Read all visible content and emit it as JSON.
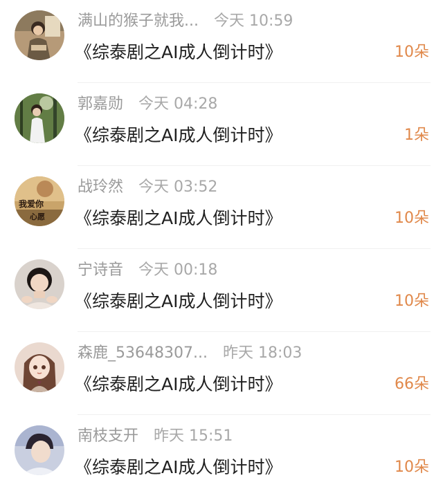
{
  "comments": [
    {
      "user": "满山的猴子就我...",
      "time": "今天 10:59",
      "title": "《综泰剧之AI成人倒计时》",
      "count": "10朵",
      "avatar": "avatar-photo-man-sitting"
    },
    {
      "user": "郭嘉勋",
      "time": "今天 04:28",
      "title": "《综泰剧之AI成人倒计时》",
      "count": "1朵",
      "avatar": "avatar-photo-girl-forest"
    },
    {
      "user": "战玲然",
      "time": "今天 03:52",
      "title": "《综泰剧之AI成人倒计时》",
      "count": "10朵",
      "avatar": "avatar-photo-text-art",
      "avatar_text": [
        "我爱你",
        "心愿"
      ]
    },
    {
      "user": "宁诗音",
      "time": "今天 00:18",
      "title": "《综泰剧之AI成人倒计时》",
      "count": "10朵",
      "avatar": "avatar-photo-woman-portrait"
    },
    {
      "user": "森鹿_53648307...",
      "time": "昨天 18:03",
      "title": "《综泰剧之AI成人倒计时》",
      "count": "66朵",
      "avatar": "avatar-illustration-girl"
    },
    {
      "user": "南枝支开",
      "time": "昨天 15:51",
      "title": "《综泰剧之AI成人倒计时》",
      "count": "10朵",
      "avatar": "avatar-photo-man-portrait"
    }
  ],
  "colors": {
    "name": "#9a9a9a",
    "title": "#1f1f1f",
    "count": "#e0884a",
    "divider": "#efefef"
  }
}
